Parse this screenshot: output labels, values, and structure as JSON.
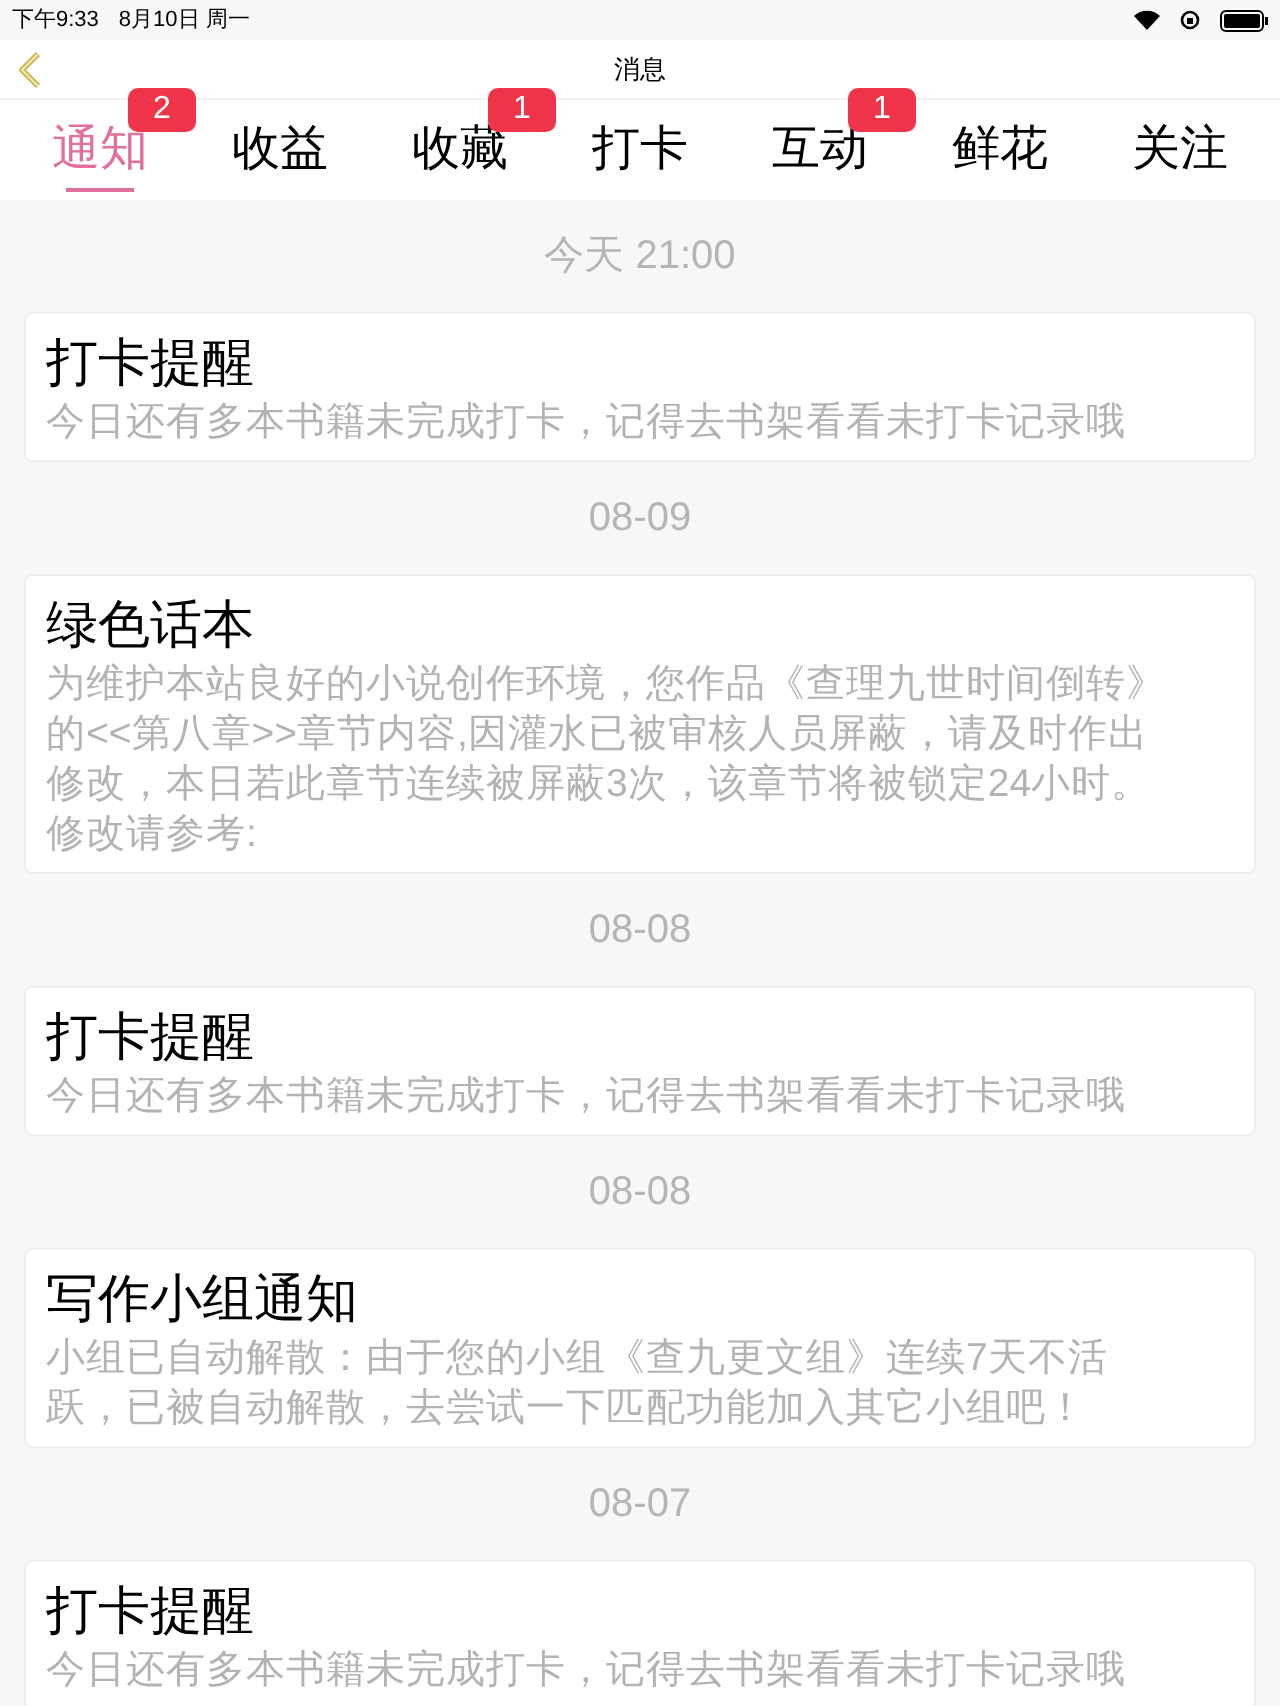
{
  "status_bar": {
    "time": "下午9:33",
    "date": "8月10日 周一"
  },
  "nav": {
    "title": "消息"
  },
  "tabs": [
    {
      "label": "通知",
      "selected": true,
      "badge": "2"
    },
    {
      "label": "收益",
      "selected": false
    },
    {
      "label": "收藏",
      "selected": false,
      "badge": "1"
    },
    {
      "label": "打卡",
      "selected": false
    },
    {
      "label": "互动",
      "selected": false,
      "badge": "1"
    },
    {
      "label": "鲜花",
      "selected": false
    },
    {
      "label": "关注",
      "selected": false
    }
  ],
  "messages": [
    {
      "date": "今天 21:00",
      "title": "打卡提醒",
      "body": "今日还有多本书籍未完成打卡，记得去书架看看未打卡记录哦"
    },
    {
      "date": "08-09",
      "title": "绿色话本",
      "body": "为维护本站良好的小说创作环境，您作品《查理九世时间倒转》的<<第八章>>章节内容,因灌水已被审核人员屏蔽，请及时作出修改，本日若此章节连续被屏蔽3次，该章节将被锁定24小时。修改请参考:"
    },
    {
      "date": "08-08",
      "title": "打卡提醒",
      "body": "今日还有多本书籍未完成打卡，记得去书架看看未打卡记录哦"
    },
    {
      "date": "08-08",
      "title": "写作小组通知",
      "body": "小组已自动解散：由于您的小组《查九更文组》连续7天不活跃，已被自动解散，去尝试一下匹配功能加入其它小组吧！"
    },
    {
      "date": "08-07",
      "title": "打卡提醒",
      "body": "今日还有多本书籍未完成打卡，记得去书架看看未打卡记录哦"
    }
  ]
}
